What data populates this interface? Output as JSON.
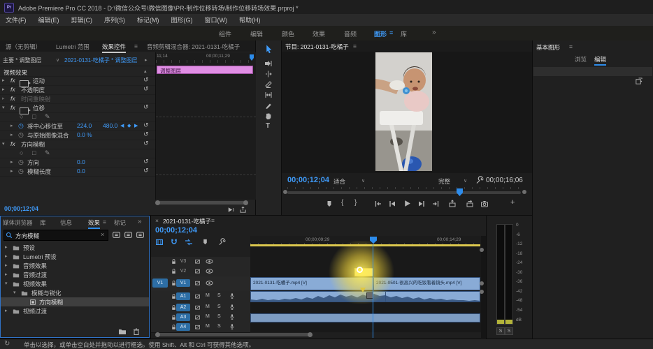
{
  "titlebar": {
    "app_badge": "Pr",
    "title": "Adobe Premiere Pro CC 2018 - D:\\微信公众号\\微信图像\\PR-制作位移转场\\制作位移转场效果.prproj *"
  },
  "menubar": {
    "items": [
      "文件(F)",
      "编辑(E)",
      "剪辑(C)",
      "序列(S)",
      "标记(M)",
      "图形(G)",
      "窗口(W)",
      "帮助(H)"
    ]
  },
  "workspace": {
    "tabs": [
      "组件",
      "编辑",
      "颜色",
      "效果",
      "音频",
      "图形",
      "库"
    ],
    "overflow": "»"
  },
  "icons": {
    "menu": "≡",
    "chev_down": "∨",
    "tri_r": "▸",
    "tri_d": "▾",
    "tri_u": "▴",
    "kf_prev": "◀",
    "kf_diamond": "◆",
    "kf_next": "▶",
    "reset": "↺",
    "stopwatch": "◷",
    "mask_ellipse": "○",
    "mask_rect": "□",
    "mask_pen": "✎",
    "close": "×",
    "brace_l": "{",
    "brace_r": "}",
    "plus": "+",
    "refresh": "↻"
  },
  "effect_controls": {
    "tabs": {
      "t1": "源（无剪辑）",
      "t2": "Lumetri 范围",
      "t3": "效果控件",
      "t4": "音频剪辑混合器: 2021-0131-吃橘子"
    },
    "header": {
      "master": "主要 * 调整图层",
      "clip": "2021-0131-吃橘子 * 调整图层"
    },
    "section": "视频效果",
    "rows": {
      "motion": "运动",
      "opacity": "不透明度",
      "time_remap": "时间重映射",
      "offset": "位移",
      "shift_center": {
        "label": "将中心移位至",
        "x": "224.0",
        "y": "480.0"
      },
      "blend": {
        "label": "与原始图像混合",
        "value": "0.0 %"
      },
      "dir_blur": "方向模糊",
      "direction": {
        "label": "方向",
        "value": "0.0"
      },
      "blur_len": {
        "label": "模糊长度",
        "value": "0.0"
      }
    },
    "mini_timeline": {
      "label_left": "11;14",
      "label_right": "00;00;11;29",
      "clip": "调整图层"
    },
    "timecode": "00;00;12;04"
  },
  "program": {
    "tab": "节目: 2021-0131-吃橘子",
    "timecode": "00;00;12;04",
    "fit": "适合",
    "quality": "完整",
    "duration": "00;00;16;06"
  },
  "essential_graphics": {
    "title": "基本图形",
    "tab_browse": "浏览",
    "tab_edit": "编辑"
  },
  "project": {
    "tabs": {
      "t1": "媒体浏览器",
      "t2": "库",
      "t3": "信息",
      "t4": "效果",
      "t5": "标记"
    },
    "overflow": "»",
    "search": {
      "value": "方向模糊"
    },
    "tree": [
      {
        "label": "预设"
      },
      {
        "label": "Lumetri 预设"
      },
      {
        "label": "音频效果"
      },
      {
        "label": "音频过渡"
      },
      {
        "label": "视频效果"
      },
      {
        "label": "模糊与锐化"
      },
      {
        "label": "方向模糊"
      },
      {
        "label": "视频过渡"
      }
    ]
  },
  "timeline": {
    "tab": "2021-0131-吃橘子",
    "timecode": "00;00;12;04",
    "ruler": {
      "m1": "00;00;09;29",
      "m2": "00;00;14;29"
    },
    "tracks": {
      "source_v": "V1",
      "v3": "V3",
      "v2": "V2",
      "v1": "V1",
      "a1": "A1",
      "a2": "A2",
      "a3": "A3",
      "a4": "A4"
    },
    "mute": "M",
    "solo": "S",
    "clips": {
      "video1": "2021-0131-吃橘子.mp4 [V]",
      "video2": "2021-0501-很高兴的吃饭看着镜头.mp4 [V]"
    }
  },
  "meters": {
    "ticks": [
      "0",
      "-6",
      "-12",
      "-18",
      "-24",
      "-30",
      "-36",
      "-42",
      "-48",
      "-54",
      "dB"
    ],
    "solo_l": "S",
    "solo_r": "S"
  },
  "statusbar": {
    "text": "单击以选择，或单击空白处并拖动以进行框选。使用 Shift、Alt 和 Ctrl 可获得其他选项。"
  }
}
